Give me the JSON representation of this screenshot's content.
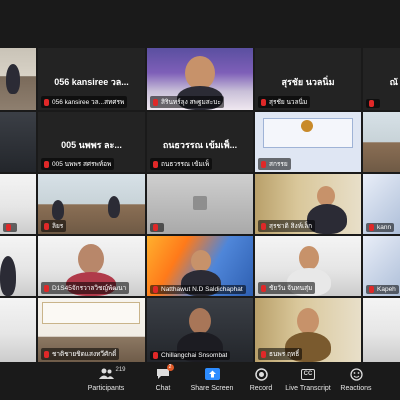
{
  "tiles": [
    {
      "id": "r0c0",
      "name": "",
      "label": ""
    },
    {
      "id": "r0c1",
      "name": "056 kansiree วล...",
      "label": "056 kansiree วล...สทศรพ"
    },
    {
      "id": "r0c2",
      "name": "",
      "label": "สิรินทร์ลุง สพฐมสะบะ"
    },
    {
      "id": "r0c3",
      "name": "สุรชัย นวลนิ่ม",
      "label": "สุรชัย นวลนิ่ม"
    },
    {
      "id": "r0c4",
      "name": "ณั",
      "label": ""
    },
    {
      "id": "r1c0",
      "name": "",
      "label": ""
    },
    {
      "id": "r1c1",
      "name": "005 นพพร  ละ...",
      "label": "005 นพพร  สศรพท์อพ"
    },
    {
      "id": "r1c2",
      "name": "ถนธวรรณ เข้มเพ็...",
      "label": "ถนธวรรณ เข้มเพ็"
    },
    {
      "id": "r1c3",
      "name": "",
      "label": "สกรรย"
    },
    {
      "id": "r1c4",
      "name": "",
      "label": ""
    },
    {
      "id": "r2c0",
      "name": "",
      "label": ""
    },
    {
      "id": "r2c1",
      "name": "",
      "label": "ลิยร"
    },
    {
      "id": "r2c2",
      "name": "",
      "label": ""
    },
    {
      "id": "r2c3",
      "name": "",
      "label": "สุรชาติ สิงห์เล็ก"
    },
    {
      "id": "r2c4",
      "name": "",
      "label": "kann"
    },
    {
      "id": "r3c0",
      "name": "",
      "label": ""
    },
    {
      "id": "r3c1",
      "name": "",
      "label": "D1S45จักรวาลวิชญ์พัฒนา"
    },
    {
      "id": "r3c2",
      "name": "",
      "label": "Natthawut N.D Saldichaphat"
    },
    {
      "id": "r3c3",
      "name": "",
      "label": "ชัยวัน จันทนสุ่ม"
    },
    {
      "id": "r3c4",
      "name": "",
      "label": "Kapeh"
    },
    {
      "id": "r4c0",
      "name": "",
      "label": ""
    },
    {
      "id": "r4c1",
      "name": "",
      "label": "ชาติชายชิดแสงทวีศักดิ์"
    },
    {
      "id": "r4c2",
      "name": "",
      "label": "Chillangchai Snsombat"
    },
    {
      "id": "r4c3",
      "name": "",
      "label": "ธนพร ฤทธิ์"
    },
    {
      "id": "r4c4",
      "name": "",
      "label": ""
    }
  ],
  "toolbar": {
    "participants_label": "Participants",
    "participants_count": "219",
    "chat_label": "Chat",
    "chat_badge": "2",
    "share_label": "Share Screen",
    "record_label": "Record",
    "transcript_label": "Live Transcript",
    "transcript_icon_text": "CC",
    "reactions_label": "Reactions"
  },
  "colors": {
    "active_border": "#f2c94c",
    "share_green": "#2d8cff",
    "mic_muted": "#e02828"
  }
}
